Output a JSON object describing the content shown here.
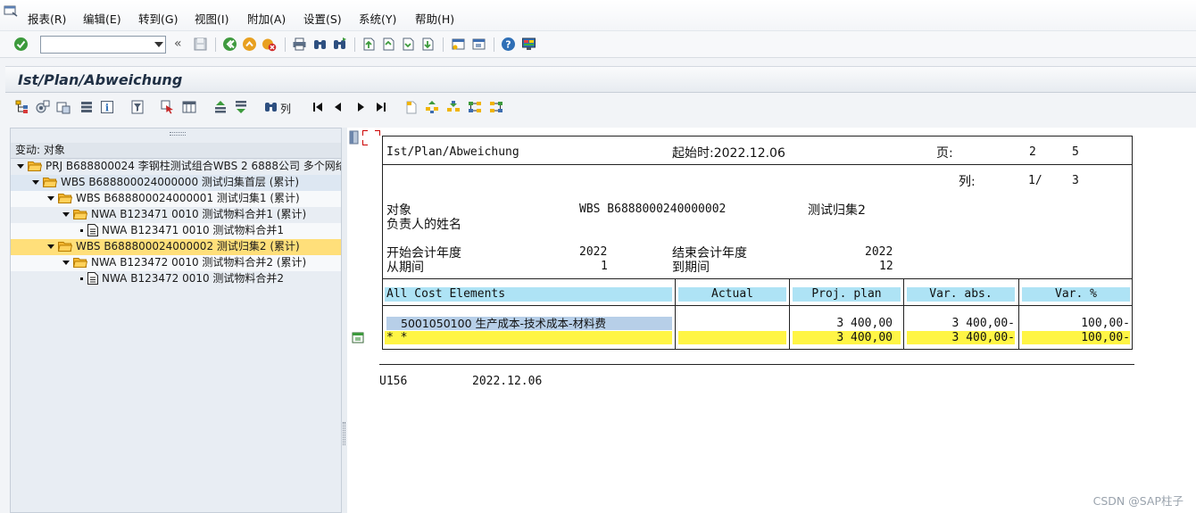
{
  "menu": [
    "报表(R)",
    "编辑(E)",
    "转到(G)",
    "视图(I)",
    "附加(A)",
    "设置(S)",
    "系统(Y)",
    "帮助(H)"
  ],
  "toolbar": {
    "command_value": "",
    "apptoolbar_label": "列"
  },
  "title": "Ist/Plan/Abweichung",
  "tree": {
    "header": "变动: 对象",
    "rows": [
      "PRJ B688800024 李钢柱测试组合WBS 2  6888公司 多个网络",
      "WBS B688800024000000 测试归集首层 (累计)",
      "WBS B688800024000001 测试归集1 (累计)",
      "NWA B123471 0010 测试物料合并1 (累计)",
      "NWA B123471 0010 测试物料合并1",
      "WBS B688800024000002 测试归集2 (累计)",
      "NWA B123472 0010 测试物料合并2 (累计)",
      "NWA B123472 0010 测试物料合并2"
    ]
  },
  "report": {
    "title": "Ist/Plan/Abweichung",
    "start_label": "起始时:2022.12.06",
    "page_label": "页:",
    "page_current": "2",
    "page_total": "5",
    "col_label": "列:",
    "col_current": "1/",
    "col_total": "3",
    "object_label": "对象",
    "object_value": "WBS B6888000240000002",
    "object_desc": "测试归集2",
    "person_label": "负责人的姓名",
    "start_year_label": "开始会计年度",
    "start_year": "2022",
    "end_year_label": "结束会计年度",
    "end_year": "2022",
    "from_period_label": "从期间",
    "from_period": "1",
    "to_period_label": "到期间",
    "to_period": "12",
    "columns": [
      "All Cost Elements",
      "Actual",
      "Proj. plan",
      "Var. abs.",
      "Var. %"
    ],
    "row1": {
      "element": "5001050100  生产成本-技术成本-材料费",
      "actual": "",
      "plan": "3 400,00",
      "var_abs": "3 400,00-",
      "var_pct": "100,00-"
    },
    "total": {
      "element": "*   *",
      "actual": "",
      "plan": "3 400,00",
      "var_abs": "3 400,00-",
      "var_pct": "100,00-"
    },
    "footer_user": "U156",
    "footer_date": "2022.12.06"
  },
  "watermark": "CSDN @SAP柱子",
  "colors": {
    "header_cell": "#aee3f5",
    "total_row": "#fff545",
    "selected_tree_row": "#ffdf7a"
  }
}
